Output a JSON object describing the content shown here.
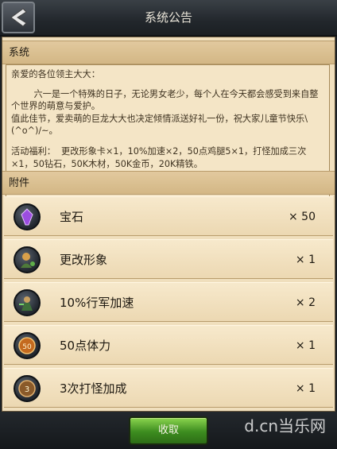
{
  "header": {
    "title": "系统公告"
  },
  "message": {
    "section_title": "系统",
    "greeting": "亲爱的各位领主大大：",
    "paragraph1": "        六一是一个特殊的日子，无论男女老少，每个人在今天都会感受到来自整个世界的萌意与爱护。",
    "paragraph2": "值此佳节，爱卖萌的巨龙大大也决定倾情派送好礼一份，祝大家儿童节快乐\\(^o^)/~。",
    "rewards": "活动福利：  更改形象卡×1，10%加速×2，50点鸡腿5×1，打怪加成三次×1，50钻石，50K木材，50K金币，20K精铁。"
  },
  "attachments": {
    "section_title": "附件",
    "items": [
      {
        "name": "宝石",
        "qty": "× 50",
        "icon": "gem-icon"
      },
      {
        "name": "更改形象",
        "qty": "× 1",
        "icon": "change-avatar-icon"
      },
      {
        "name": "10%行军加速",
        "qty": "× 2",
        "icon": "march-speedup-icon"
      },
      {
        "name": "50点体力",
        "qty": "× 1",
        "icon": "stamina-icon"
      },
      {
        "name": "3次打怪加成",
        "qty": "× 1",
        "icon": "monster-bonus-icon"
      }
    ]
  },
  "footer": {
    "collect_label": "收取"
  },
  "watermark": "d.cn当乐网",
  "colors": {
    "accent_green": "#4ea428",
    "panel": "#f0dfbd"
  }
}
